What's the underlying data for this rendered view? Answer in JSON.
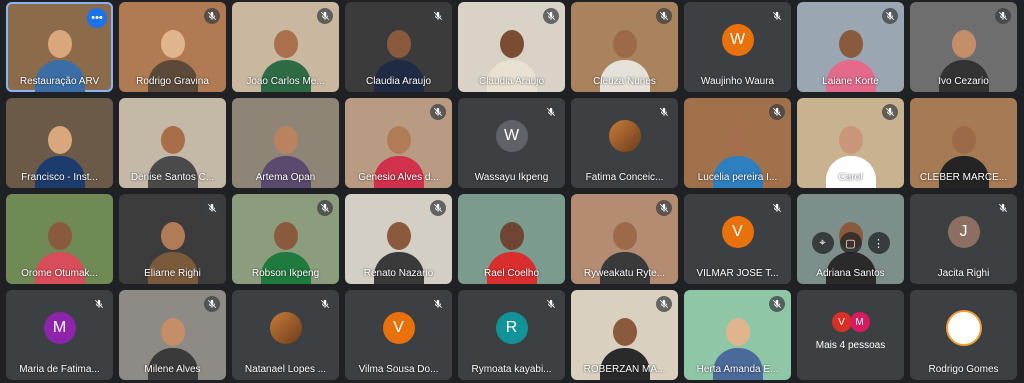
{
  "colors": {
    "background": "#202124",
    "tile": "#3c4043",
    "accent": "#1a73e8",
    "avatar_orange": "#e8710a",
    "avatar_purple": "#8e24aa",
    "avatar_teal": "#12939a",
    "avatar_grey": "#5f6368",
    "avatar_brown": "#8d6e63"
  },
  "more_menu_glyph": "⋮⋮",
  "tiles": [
    {
      "name": "Restauração ARV",
      "type": "video",
      "bg": "#8c6b4a",
      "skin": "#d9a77b",
      "shirt": "#3b6ea5",
      "active": true,
      "more": true,
      "muted": false
    },
    {
      "name": "Rodrigo Gravina",
      "type": "video",
      "bg": "#b07a52",
      "skin": "#e0b48d",
      "shirt": "#5b4a3a",
      "muted": true
    },
    {
      "name": "Joao Carlos Me...",
      "type": "video",
      "bg": "#c9b79f",
      "skin": "#a8704c",
      "shirt": "#2d6b45",
      "muted": true
    },
    {
      "name": "Claudia Araujo",
      "type": "video",
      "bg": "#3b3b3b",
      "skin": "#8a5a3c",
      "shirt": "#1f2a44",
      "muted": true
    },
    {
      "name": "Claudia Araujo",
      "type": "video",
      "bg": "#d9d3c7",
      "skin": "#7a4c33",
      "shirt": "#e8e1d1",
      "muted": true
    },
    {
      "name": "Cleuza Nunes",
      "type": "video",
      "bg": "#a8835e",
      "skin": "#9c6a48",
      "shirt": "#e5e0d8",
      "muted": true
    },
    {
      "name": "Waujinho Waura",
      "type": "avatar",
      "initial": "W",
      "color": "#e8710a",
      "muted": true
    },
    {
      "name": "Laiane Korte",
      "type": "video",
      "bg": "#9aa7b3",
      "skin": "#8a5a3c",
      "shirt": "#e36a8a",
      "muted": true
    },
    {
      "name": "Ivo Cezario",
      "type": "video",
      "bg": "#6e6e6e",
      "skin": "#c48e68",
      "shirt": "#333333",
      "muted": true
    },
    {
      "name": "Francisco - Inst...",
      "type": "video",
      "bg": "#6b5a48",
      "skin": "#d9a77b",
      "shirt": "#1d3c6e",
      "muted": false
    },
    {
      "name": "Denise Santos C...",
      "type": "video",
      "bg": "#c4b8a7",
      "skin": "#a86e4a",
      "shirt": "#4a4a4a",
      "muted": false
    },
    {
      "name": "Artema Opan",
      "type": "video",
      "bg": "#8e8577",
      "skin": "#b98360",
      "shirt": "#5c4a6e",
      "muted": false
    },
    {
      "name": "Genesio Alves d...",
      "type": "video",
      "bg": "#b89b82",
      "skin": "#b07c58",
      "shirt": "#d1314b",
      "muted": true
    },
    {
      "name": "Wassayu Ikpeng",
      "type": "avatar",
      "initial": "W",
      "color": "#5f6368",
      "muted": true
    },
    {
      "name": "Fatima Conceic...",
      "type": "photo",
      "muted": true
    },
    {
      "name": "Lucelia pereira I...",
      "type": "video",
      "bg": "#a0714a",
      "skin": "#a56e4c",
      "shirt": "#2e7fbf",
      "muted": true
    },
    {
      "name": "Carol",
      "type": "video",
      "bg": "#c8b28f",
      "skin": "#c9967a",
      "shirt": "#ffffff",
      "muted": true
    },
    {
      "name": "CLEBER MARCE...",
      "type": "video",
      "bg": "#a57a55",
      "skin": "#9c6a48",
      "shirt": "#242424",
      "muted": false
    },
    {
      "name": "Orome Otumak...",
      "type": "video",
      "bg": "#6f8a55",
      "skin": "#8a5a3c",
      "shirt": "#d84d5a",
      "muted": false
    },
    {
      "name": "Eliarne Righi",
      "type": "video",
      "bg": "#3c3c3c",
      "skin": "#b07c58",
      "shirt": "#7b5a3c",
      "muted": true
    },
    {
      "name": "Robson Ikpeng",
      "type": "video",
      "bg": "#8c9d7e",
      "skin": "#8a5a3c",
      "shirt": "#1f7a3d",
      "muted": true
    },
    {
      "name": "Renato Nazario",
      "type": "video",
      "bg": "#d4cfc4",
      "skin": "#8a5a3c",
      "shirt": "#3a3a3a",
      "muted": true
    },
    {
      "name": "Rael Coelho",
      "type": "video",
      "bg": "#7b9b8e",
      "skin": "#6e4632",
      "shirt": "#d92e2e",
      "muted": false
    },
    {
      "name": "Ryweakatu Ryte...",
      "type": "video",
      "bg": "#b48c72",
      "skin": "#9c6a48",
      "shirt": "#3a3a3a",
      "muted": true
    },
    {
      "name": "VILMAR JOSE T...",
      "type": "avatar",
      "initial": "V",
      "color": "#e8710a",
      "muted": true
    },
    {
      "name": "Adriana Santos",
      "type": "video",
      "bg": "#7d8f8a",
      "skin": "#8a5a3c",
      "shirt": "#2a2a2a",
      "muted": false,
      "controls": true
    },
    {
      "name": "Jacita Righi",
      "type": "avatar",
      "initial": "J",
      "color": "#8d6e63",
      "muted": true
    },
    {
      "name": "Maria de Fatima...",
      "type": "avatar",
      "initial": "M",
      "color": "#8e24aa",
      "muted": true
    },
    {
      "name": "Milene Alves",
      "type": "video",
      "bg": "#8e8b86",
      "skin": "#c48e68",
      "shirt": "#3a3a3a",
      "muted": true
    },
    {
      "name": "Natanael Lopes ...",
      "type": "photo",
      "muted": true
    },
    {
      "name": "Vilma Sousa Do...",
      "type": "avatar",
      "initial": "V",
      "color": "#e8710a",
      "muted": true
    },
    {
      "name": "Rymoata kayabi...",
      "type": "avatar",
      "initial": "R",
      "color": "#12939a",
      "muted": true
    },
    {
      "name": "ROBERZAN MA...",
      "type": "video",
      "bg": "#d9d0c0",
      "skin": "#8a5a3c",
      "shirt": "#2a2a2a",
      "muted": true
    },
    {
      "name": "Herta Amanda E...",
      "type": "video",
      "bg": "#8fc7a6",
      "skin": "#e0b48d",
      "shirt": "#4a6a9a",
      "muted": true
    },
    {
      "name": "Mais 4 pessoas",
      "type": "more_people",
      "initials": [
        "V",
        "M"
      ],
      "colors": [
        "#d93025",
        "#d81b60"
      ],
      "muted": false
    },
    {
      "name": "Rodrigo Gomes",
      "type": "logo",
      "muted": false
    }
  ]
}
